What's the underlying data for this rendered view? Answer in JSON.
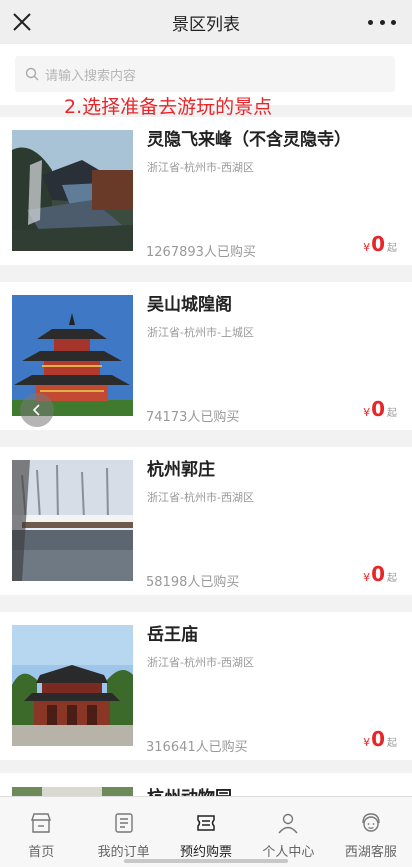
{
  "header": {
    "title": "景区列表"
  },
  "search": {
    "placeholder": "请输入搜索内容"
  },
  "annotation": "2.选择准备去游玩的景点",
  "spots": [
    {
      "title": "灵隐飞来峰（不含灵隐寺）",
      "region": "浙江省-杭州市-西湖区",
      "sold": "1267893人已购买",
      "currency": "¥",
      "price": "0",
      "suffix": "起"
    },
    {
      "title": "吴山城隍阁",
      "region": "浙江省-杭州市-上城区",
      "sold": "74173人已购买",
      "currency": "¥",
      "price": "0",
      "suffix": "起"
    },
    {
      "title": "杭州郭庄",
      "region": "浙江省-杭州市-西湖区",
      "sold": "58198人已购买",
      "currency": "¥",
      "price": "0",
      "suffix": "起"
    },
    {
      "title": "岳王庙",
      "region": "浙江省-杭州市-西湖区",
      "sold": "316641人已购买",
      "currency": "¥",
      "price": "0",
      "suffix": "起"
    }
  ],
  "partial_spot": {
    "title": "杭州动物园"
  },
  "tabbar": {
    "items": [
      {
        "label": "首页",
        "icon": "store-icon"
      },
      {
        "label": "我的订单",
        "icon": "order-list-icon"
      },
      {
        "label": "预约购票",
        "icon": "ticket-icon"
      },
      {
        "label": "个人中心",
        "icon": "person-icon"
      },
      {
        "label": "西湖客服",
        "icon": "customer-service-icon"
      }
    ]
  },
  "colors": {
    "accent": "#e8262a",
    "muted": "#999999"
  }
}
